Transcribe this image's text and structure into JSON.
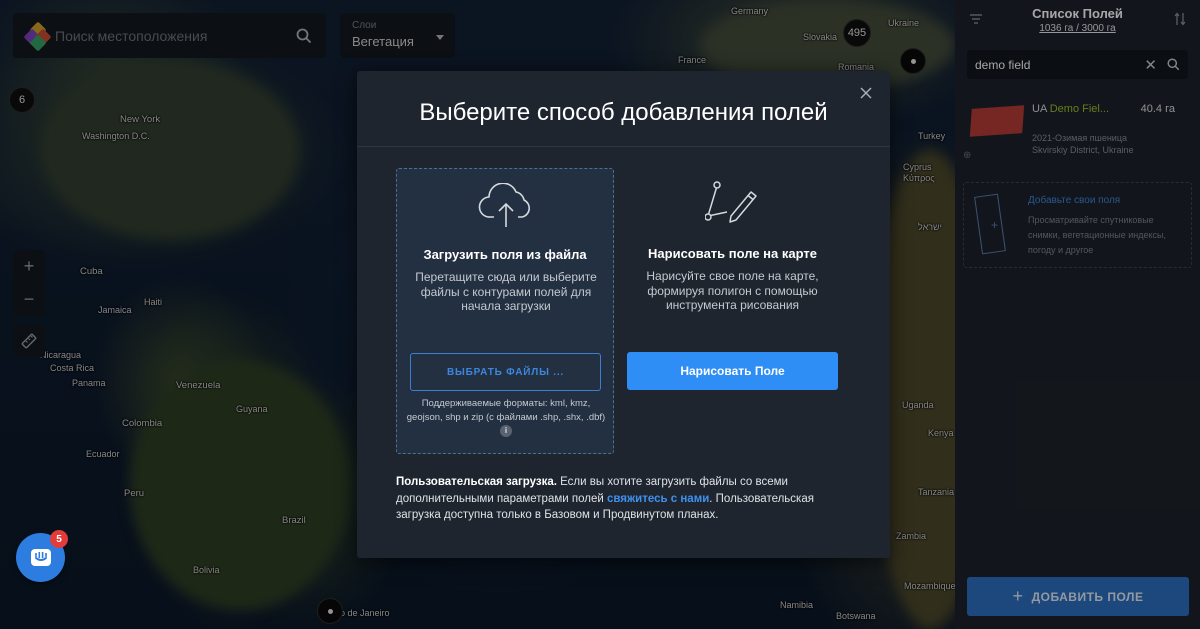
{
  "map": {
    "search_placeholder": "Поиск местоположения",
    "layer": {
      "caption": "Слои",
      "value": "Вегетация"
    },
    "zoom_in": "+",
    "zoom_out": "−",
    "clusters": [
      "6",
      "495"
    ],
    "labels": {
      "germany": "Germany",
      "ukraine": "Ukraine",
      "slovakia": "Slovakia",
      "romania": "Romania",
      "france": "France",
      "new_york": "New York",
      "washington": "Washington D.C.",
      "turkey": "Turkey",
      "cyprus": "Cyprus\nΚύπρος",
      "israel": "ישראל",
      "cuba": "Cuba",
      "jamaica": "Jamaica",
      "haiti": "Haiti",
      "nicaragua": "Nicaragua",
      "costa_rica": "Costa Rica",
      "panama": "Panama",
      "venezuela": "Venezuela",
      "guyana": "Guyana",
      "colombia": "Colombia",
      "ecuador": "Ecuador",
      "peru": "Peru",
      "brazil": "Brazil",
      "bolivia": "Bolivia",
      "rio": "o de Janeiro",
      "uganda": "Uganda",
      "kenya": "Kenya",
      "tanzania": "Tanzania",
      "zambia": "Zambia",
      "mozambique": "Mozambique",
      "botswana": "Botswana",
      "namibia": "Namibia"
    },
    "chat_badge": "5"
  },
  "panel": {
    "title": "Список Полей",
    "subtitle": "1036 га / 3000 га",
    "search_value": "demo field",
    "field": {
      "prefix": "UA ",
      "name_highlight": "Demo Fiel...",
      "area": "40.4 га",
      "crop": "2021-Озимая пшеница",
      "location": "Skvirskiy District, Ukraine"
    },
    "add_card": {
      "title": "Добавьте свои поля",
      "desc": "Просматривайте спутниковые снимки, вегетационные индексы, погоду и другое"
    },
    "add_button": "ДОБАВИТЬ ПОЛЕ"
  },
  "modal": {
    "title": "Выберите способ добавления полей",
    "upload": {
      "title": "Загрузить поля из файла",
      "desc": "Перетащите сюда или выберите файлы с контурами полей для начала загрузки",
      "button": "ВЫБРАТЬ ФАЙЛЫ ...",
      "formats": "Поддерживаемые форматы: kml, kmz, geojson, shp и zip (с файлами .shp, .shx, .dbf)"
    },
    "draw": {
      "title": "Нарисовать поле на карте",
      "desc": "Нарисуйте свое поле на карте, формируя полигон с помощью инструмента рисования",
      "button": "Нарисовать Поле"
    },
    "custom": {
      "bold": "Пользовательская загрузка.",
      "text1": " Если вы хотите загрузить файлы со всеми дополнительными параметрами полей ",
      "link": "свяжитесь с нами",
      "text2": ". Пользовательская загрузка доступна только в Базовом и Продвинутом планах."
    }
  },
  "colors": {
    "accent": "#2f8ef5",
    "modal_bg": "#1e252e",
    "panel_bg": "#1d232b",
    "field_highlight": "#9bbf2a",
    "badge": "#e33a3a"
  }
}
